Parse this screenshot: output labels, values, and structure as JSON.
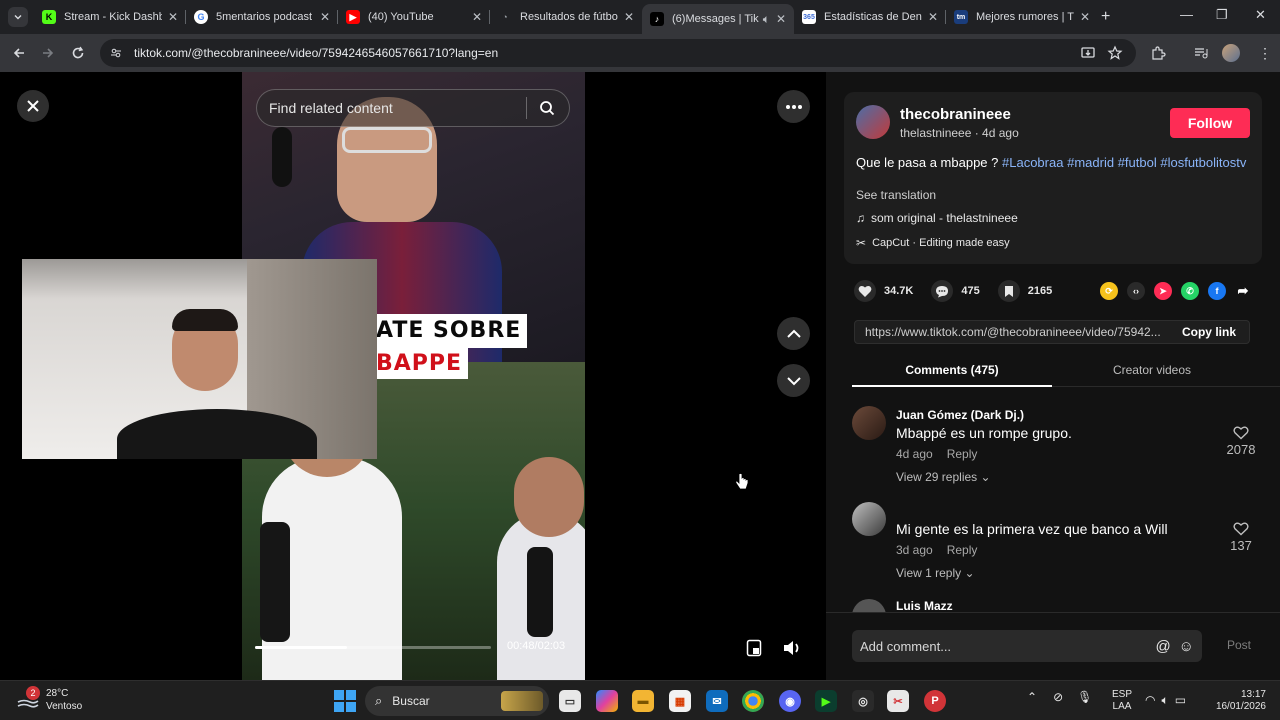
{
  "browser": {
    "tabs": [
      {
        "title": "Stream - Kick Dashbo",
        "favicon": "kick-icon",
        "color": "#53fc18"
      },
      {
        "title": "5mentarios podcast",
        "favicon": "google-icon",
        "color": "#4285f4"
      },
      {
        "title": "(40) YouTube",
        "favicon": "youtube-icon",
        "color": "#ff0000"
      },
      {
        "title": "Resultados de fútbol",
        "favicon": "scores-icon",
        "color": "#9aa0a6"
      },
      {
        "title": "(6)Messages | Tik",
        "favicon": "tiktok-icon",
        "color": "#ffffff"
      },
      {
        "title": "Estadísticas de Deni",
        "favicon": "stats-icon",
        "color": "#3b6bd6"
      },
      {
        "title": "Mejores rumores | Tr",
        "favicon": "transfermarkt-icon",
        "color": "#1a3d7c"
      }
    ],
    "active_tab": 4,
    "url": "tiktok.com/@thecobranineee/video/7594246546057661710?lang=en"
  },
  "video": {
    "search_placeholder": "Find related content",
    "banner_line1": "ATE SOBRE",
    "banner_line2": "BAPPE",
    "time": "00:48/02:03",
    "progress": 0.39,
    "accent_color": "#fe2c55"
  },
  "author": {
    "username": "thecobranineee",
    "meta": "thelastnineee · 4d ago",
    "follow_label": "Follow"
  },
  "caption": {
    "text": "Que le pasa a mbappe ?",
    "hashtags": [
      "#Lacobraa",
      "#madrid",
      "#futbol",
      "#losfutbolitostv"
    ],
    "see_translation": "See translation",
    "sound": "som original - thelastnineee",
    "capcut": "CapCut · Editing made easy"
  },
  "stats": {
    "likes": "34.7K",
    "comments": "475",
    "saves": "2165"
  },
  "share": {
    "link": "https://www.tiktok.com/@thecobranineee/video/75942...",
    "copy_label": "Copy link"
  },
  "tabs": {
    "comments_label": "Comments (475)",
    "creator_label": "Creator videos"
  },
  "comments": [
    {
      "user": "Juan Gómez (Dark Dj.)",
      "text": "Mbappé es un rompe grupo.",
      "time": "4d ago",
      "reply_label": "Reply",
      "likes": "2078",
      "view_replies": "View 29 replies"
    },
    {
      "user": "",
      "text": "Mi gente es la primera vez que banco a Will",
      "time": "3d ago",
      "reply_label": "Reply",
      "likes": "137",
      "view_replies": "View 1 reply"
    },
    {
      "user": "Luis Mazz",
      "text": "",
      "time": "",
      "reply_label": "",
      "likes": "",
      "view_replies": ""
    }
  ],
  "comment_box": {
    "placeholder": "Add comment...",
    "post_label": "Post"
  },
  "taskbar": {
    "weather_temp": "28°C",
    "weather_desc": "Ventoso",
    "weather_badge": "2",
    "search_label": "Buscar",
    "lang_line1": "ESP",
    "lang_line2": "LAA",
    "time": "13:17",
    "date": "16/01/2026"
  }
}
